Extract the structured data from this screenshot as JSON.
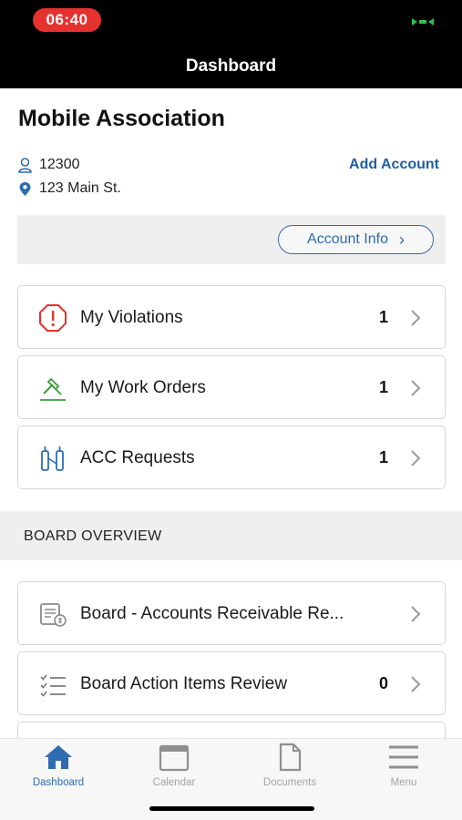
{
  "status_bar": {
    "time": "06:40"
  },
  "header": {
    "title": "Dashboard"
  },
  "account": {
    "association_name": "Mobile Association",
    "account_number": "12300",
    "address": "123 Main St.",
    "add_account_label": "Add Account",
    "account_info_label": "Account Info"
  },
  "items": [
    {
      "label": "My Violations",
      "count": "1",
      "icon": "warning-octagon-icon"
    },
    {
      "label": "My Work Orders",
      "count": "1",
      "icon": "hammer-icon"
    },
    {
      "label": "ACC Requests",
      "count": "1",
      "icon": "building-icon"
    }
  ],
  "board": {
    "section_title": "BOARD OVERVIEW",
    "items": [
      {
        "label": "Board - Accounts Receivable Re...",
        "count": "",
        "icon": "receivable-report-icon"
      },
      {
        "label": "Board Action Items Review",
        "count": "0",
        "icon": "checklist-icon"
      }
    ]
  },
  "tabs": [
    {
      "label": "Dashboard",
      "icon": "home-icon",
      "active": true
    },
    {
      "label": "Calendar",
      "icon": "calendar-icon",
      "active": false
    },
    {
      "label": "Documents",
      "icon": "document-icon",
      "active": false
    },
    {
      "label": "Menu",
      "icon": "menu-icon",
      "active": false
    }
  ],
  "colors": {
    "accent": "#2d6cb0",
    "alert_red": "#e5322f",
    "work_green": "#3a9d3a",
    "acc_blue": "#2d6cb0"
  }
}
